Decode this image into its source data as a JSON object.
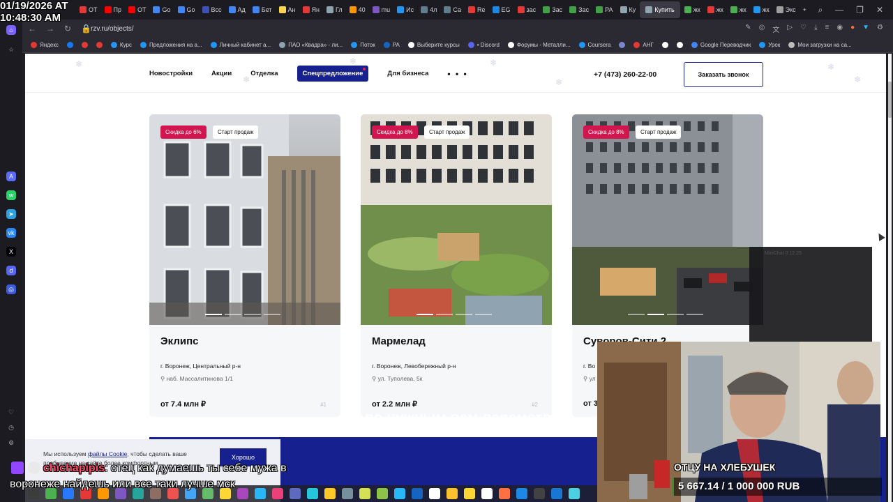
{
  "overlay": {
    "clock_line1": "01/19/2026 AT",
    "clock_line2": "10:48:30 AM"
  },
  "browser": {
    "tabs": [
      {
        "label": "OT",
        "color": "#e53935"
      },
      {
        "label": "Пр",
        "color": "#ff0000"
      },
      {
        "label": "OT",
        "color": "#ff0000"
      },
      {
        "label": "Go",
        "color": "#4285f4"
      },
      {
        "label": "Go",
        "color": "#4285f4"
      },
      {
        "label": "Всс",
        "color": "#3f51b5"
      },
      {
        "label": "Ад",
        "color": "#4285f4"
      },
      {
        "label": "Бет",
        "color": "#4285f4"
      },
      {
        "label": "Ан",
        "color": "#ffd54f"
      },
      {
        "label": "Ян",
        "color": "#e53935"
      },
      {
        "label": "Гл",
        "color": "#90a4ae"
      },
      {
        "label": "40",
        "color": "#ff9800"
      },
      {
        "label": "mu",
        "color": "#7e57c2"
      },
      {
        "label": "Ис",
        "color": "#2196f3"
      },
      {
        "label": "4л",
        "color": "#607d8b"
      },
      {
        "label": "Са",
        "color": "#607d8b"
      },
      {
        "label": "Re",
        "color": "#e53935"
      },
      {
        "label": "EG",
        "color": "#1e88e5"
      },
      {
        "label": "зас",
        "color": "#e53935"
      },
      {
        "label": "Зас",
        "color": "#43a047"
      },
      {
        "label": "Зас",
        "color": "#43a047"
      },
      {
        "label": "РА",
        "color": "#43a047"
      },
      {
        "label": "Ку",
        "color": "#90a4ae"
      },
      {
        "label": "Купить",
        "color": "#90a4ae",
        "active": true
      },
      {
        "label": "жк",
        "color": "#4caf50"
      },
      {
        "label": "жк",
        "color": "#e53935"
      },
      {
        "label": "жк",
        "color": "#4caf50"
      },
      {
        "label": "жк",
        "color": "#2196f3"
      },
      {
        "label": "Экс",
        "color": "#9e9e9e"
      }
    ],
    "new_tab": "+",
    "url": "rzv.ru/objects/",
    "bookmarks": [
      {
        "label": "Яндекс",
        "color": "#e53935"
      },
      {
        "label": "",
        "color": "#1877f2"
      },
      {
        "label": "",
        "color": "#e53935"
      },
      {
        "label": "",
        "color": "#e53935"
      },
      {
        "label": "Курс",
        "color": "#2196f3"
      },
      {
        "label": "Предложения на а...",
        "color": "#2196f3"
      },
      {
        "label": "Личный кабинет а...",
        "color": "#2196f3"
      },
      {
        "label": "ПАО «Квадра» - ли...",
        "color": "#90a4ae"
      },
      {
        "label": "Поток",
        "color": "#2196f3"
      },
      {
        "label": "РА",
        "color": "#1565c0"
      },
      {
        "label": "Выберите курсы",
        "color": "#ffffff"
      },
      {
        "label": "• Discord",
        "color": "#5865f2"
      },
      {
        "label": "Форумы - Металли...",
        "color": "#ffffff"
      },
      {
        "label": "Coursera",
        "color": "#2196f3"
      },
      {
        "label": "",
        "color": "#7986cb"
      },
      {
        "label": "АНГ",
        "color": "#e53935"
      },
      {
        "label": "",
        "color": "#ffffff"
      },
      {
        "label": "",
        "color": "#ffffff"
      },
      {
        "label": "Google Переводчик",
        "color": "#4285f4"
      },
      {
        "label": "Урок",
        "color": "#2196f3"
      },
      {
        "label": "Мои загрузки на са...",
        "color": "#bdbdbd"
      }
    ]
  },
  "site": {
    "nav": {
      "new_buildings": "Новостройки",
      "promotions": "Акции",
      "finishing": "Отделка",
      "special_offer": "Спецпредложение",
      "business": "Для бизнеса",
      "more": "• • •"
    },
    "phone": "+7 (473) 260-22-00",
    "call_button": "Заказать звонок",
    "cards": [
      {
        "badge_discount": "Скидка до 6%",
        "badge_status": "Старт продаж",
        "title": "Эклипс",
        "city": "г. Воронеж, Центральный р-н",
        "address": "наб. Массалитинова 1/1",
        "price": "от 7.4 млн ₽",
        "number": "#1"
      },
      {
        "badge_discount": "Скидка до 8%",
        "badge_status": "Старт продаж",
        "title": "Мармелад",
        "city": "г. Воронеж, Левобережный р-н",
        "address": "ул. Туполева, 5к",
        "price": "от 2.2 млн ₽",
        "number": "#2"
      },
      {
        "badge_discount": "Скидка до 8%",
        "badge_status": "Старт продаж",
        "title": "Суворов-Сити 2",
        "city": "г. Во",
        "address": "ул",
        "price": "от 3",
        "number": ""
      }
    ],
    "cookie": {
      "text_prefix": "Мы используем",
      "link": "файлы Cookie",
      "text_suffix": ", чтобы сделать ваше пребывание на сайте более комфортным",
      "button": "Хорошо"
    },
    "banner_text": "по нужным вам параметр"
  },
  "minichat": {
    "title": "MiniChat 0.12.25"
  },
  "stream": {
    "chat_user": "chichapipis",
    "chat_message": ": отец как думаешь ты себе мужа в",
    "chat_message_line2": "воронеже найдешь или все таки лучше мск",
    "chat_ghost_text": "ру мечты",
    "goal_label": "ОТЦУ НА ХЛЕБУШЕК",
    "goal_text": "5 667.14 / 1 000 000 RUB",
    "goal_progress": 0.00567
  }
}
